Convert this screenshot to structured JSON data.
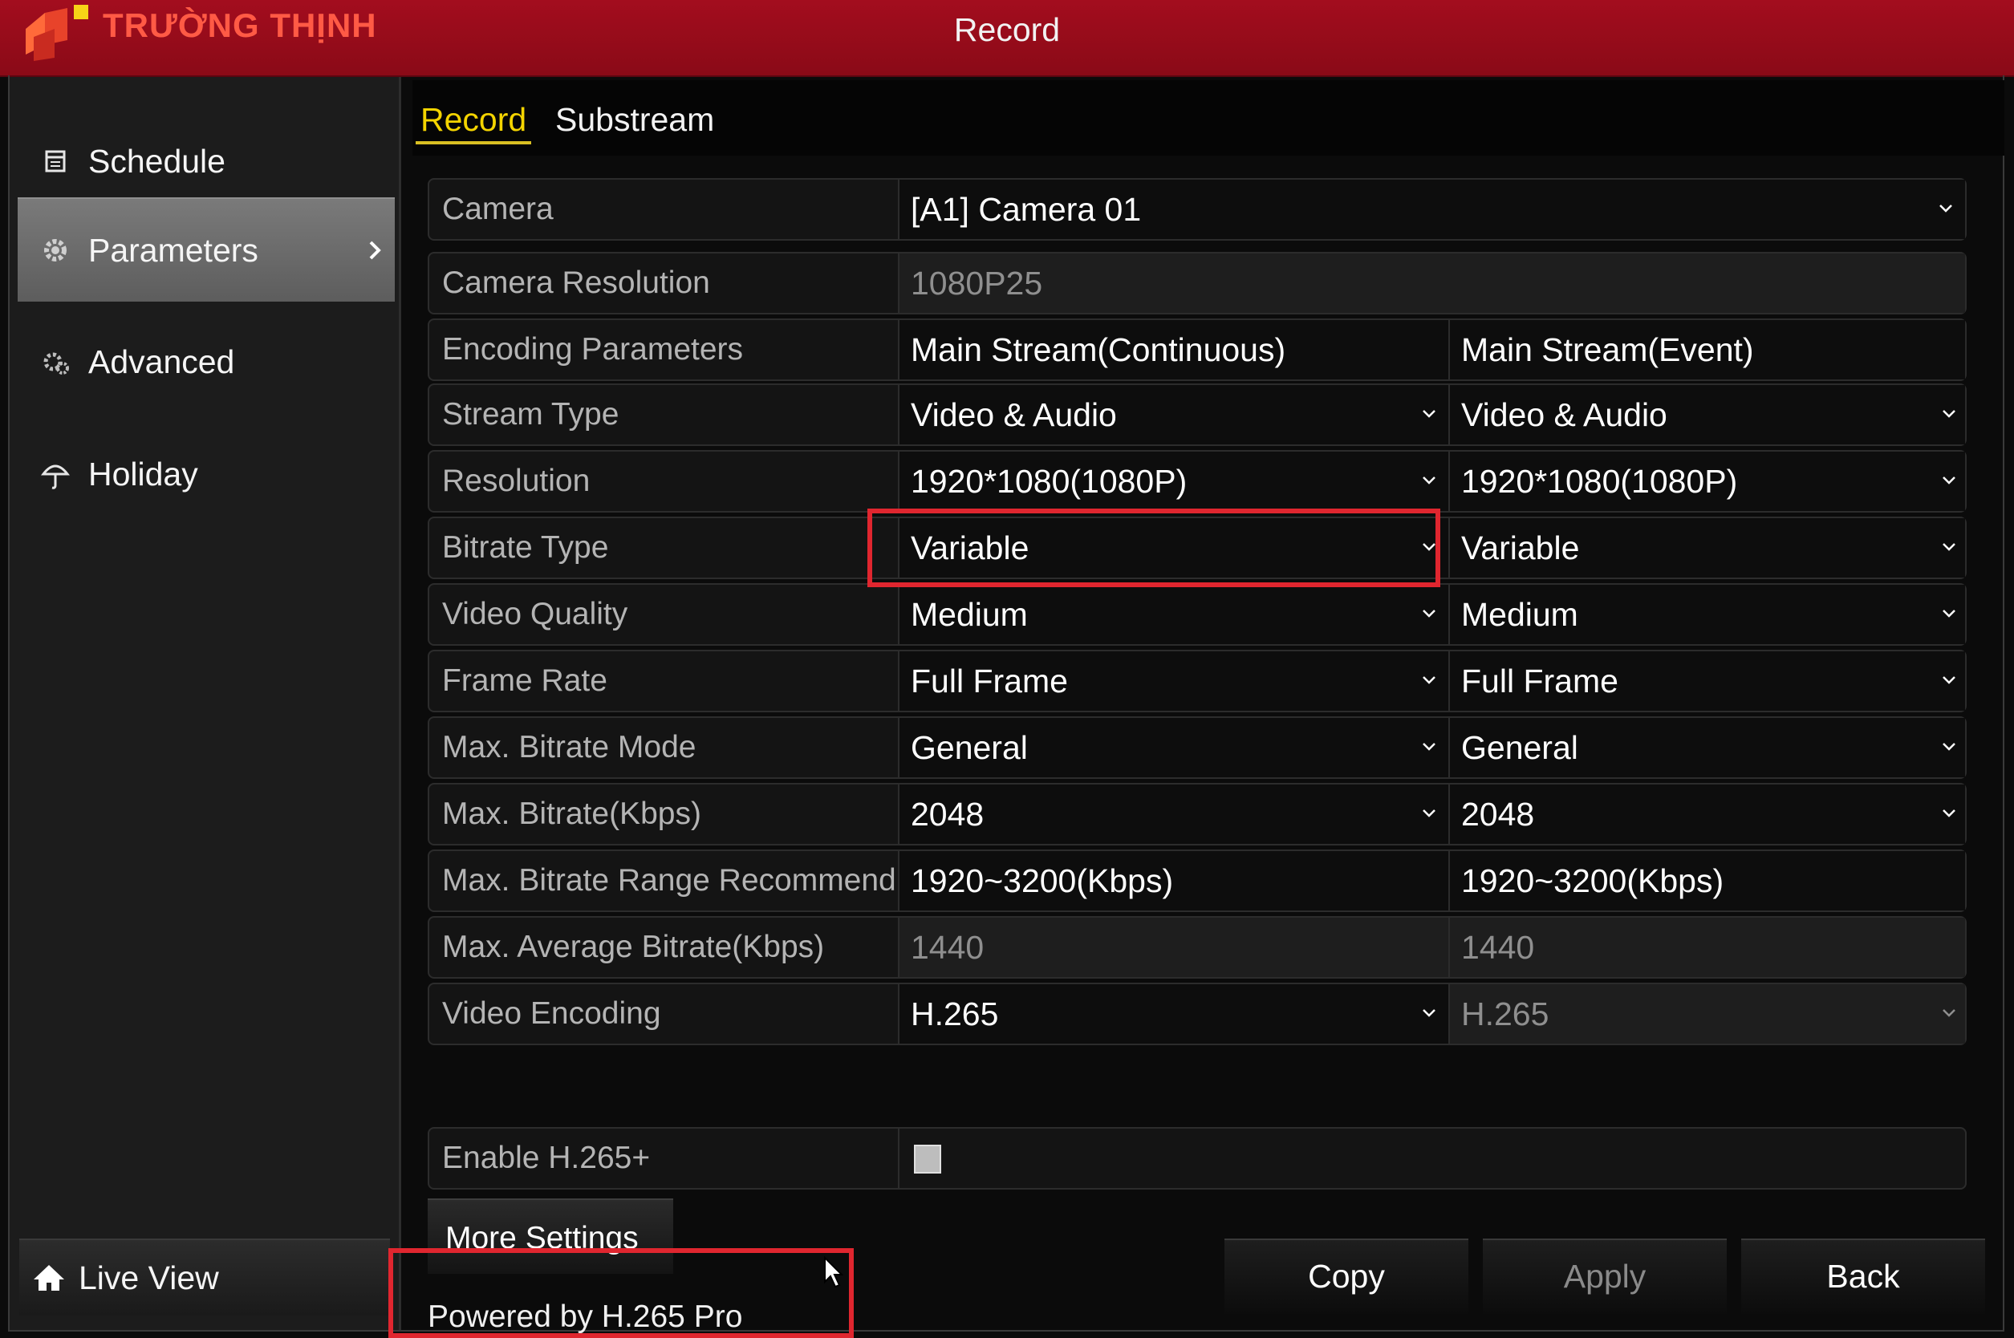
{
  "window": {
    "title": "Record"
  },
  "logo": {
    "text": "TRƯỜNG THỊNH"
  },
  "sidebar": {
    "items": [
      {
        "label": "Schedule",
        "icon": "calendar-icon"
      },
      {
        "label": "Parameters",
        "icon": "gear-icon",
        "selected": true
      },
      {
        "label": "Advanced",
        "icon": "gears-icon"
      },
      {
        "label": "Holiday",
        "icon": "umbrella-icon"
      }
    ],
    "liveview": {
      "label": "Live View",
      "icon": "home-icon"
    }
  },
  "tabs": [
    {
      "label": "Record",
      "active": true
    },
    {
      "label": "Substream",
      "active": false
    }
  ],
  "form": {
    "camera": {
      "label": "Camera",
      "value": "[A1] Camera 01"
    },
    "resolution_info": {
      "label": "Camera Resolution",
      "value": "1080P25"
    },
    "encoding": {
      "label": "Encoding Parameters",
      "continuous": "Main Stream(Continuous)",
      "event": "Main Stream(Event)"
    },
    "stream_type": {
      "label": "Stream Type",
      "continuous": "Video & Audio",
      "event": "Video & Audio"
    },
    "resolution": {
      "label": "Resolution",
      "continuous": "1920*1080(1080P)",
      "event": "1920*1080(1080P)"
    },
    "bitrate_type": {
      "label": "Bitrate Type",
      "continuous": "Variable",
      "event": "Variable"
    },
    "video_quality": {
      "label": "Video Quality",
      "continuous": "Medium",
      "event": "Medium"
    },
    "frame_rate": {
      "label": "Frame Rate",
      "continuous": "Full Frame",
      "event": "Full Frame"
    },
    "max_bitrate_mode": {
      "label": "Max. Bitrate Mode",
      "continuous": "General",
      "event": "General"
    },
    "max_bitrate": {
      "label": "Max. Bitrate(Kbps)",
      "continuous": "2048",
      "event": "2048"
    },
    "bitrate_range": {
      "label": "Max. Bitrate Range Recommend...",
      "continuous": "1920~3200(Kbps)",
      "event": "1920~3200(Kbps)"
    },
    "avg_bitrate": {
      "label": "Max. Average Bitrate(Kbps)",
      "continuous": "1440",
      "event": "1440"
    },
    "video_encoding": {
      "label": "Video Encoding",
      "continuous": "H.265",
      "event": "H.265"
    },
    "h265plus": {
      "label": "Enable H.265+",
      "checked": false
    }
  },
  "buttons": {
    "more_settings": "More Settings",
    "copy": "Copy",
    "apply": "Apply",
    "back": "Back"
  },
  "footer": {
    "powered": "Powered by H.265 Pro"
  },
  "colors": {
    "titlebar": "#a30d1e",
    "active_tab": "#f4d400",
    "highlight": "#e0262f"
  }
}
